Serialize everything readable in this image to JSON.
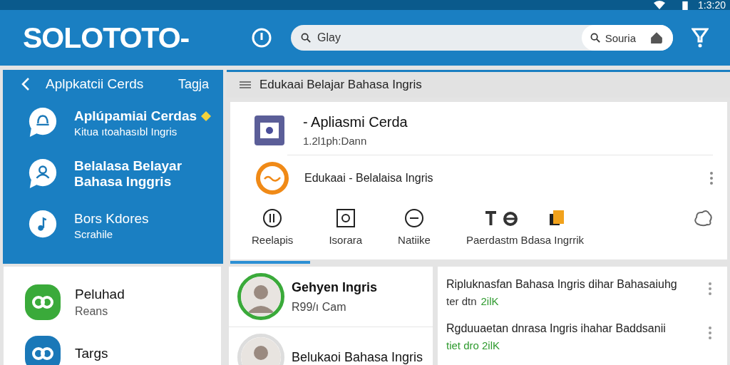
{
  "status_bar": {
    "time": "1:3:20"
  },
  "header": {
    "logo": "SOLOTOTO-",
    "search": {
      "placeholder": "Glay"
    },
    "search_button": "Souria"
  },
  "sidebar": {
    "title": "Aplpkatcii Cerds",
    "action": "Tagja",
    "items": [
      {
        "kind": "chat",
        "title": "Aplúpamiai Cerdas",
        "subtitle": "Kitua ıtoahasıbl Ingris",
        "starred": true
      },
      {
        "kind": "person",
        "title": "Belalasa Belayar Bahasa Inggris",
        "starred": false
      },
      {
        "kind": "music",
        "title": "Bors Kdores",
        "subtitle": "Scrahile",
        "starred": false
      }
    ]
  },
  "content": {
    "heading": "Edukaai Belajar Bahasa Ingris",
    "card": {
      "title": "- Apliasmi Cerda",
      "subtitle": "1.2l1ph:Dann",
      "app_name": "Edukaai - Belalaisa Ingris",
      "tabs": [
        {
          "kind": "circle-bars",
          "label": "Reelapis"
        },
        {
          "kind": "square",
          "label": "Isorara"
        },
        {
          "kind": "circle-dash",
          "label": "Natiike"
        },
        {
          "kind": "to",
          "label": "Paerdastm Bdasa Ingrrik"
        }
      ]
    },
    "progress": {
      "level": 0.16
    }
  },
  "apps": [
    {
      "color": "#3aaa3a",
      "title": "Peluhad",
      "subtitle": "Reans"
    },
    {
      "color": "#1a78b8",
      "title": "Targs"
    }
  ],
  "people": [
    {
      "name": "Gehyen Ingris",
      "meta": "R99/ı Cam",
      "color": "#3aaa3a"
    },
    {
      "name": "Belukaoi Bahasa Ingris",
      "color": "#dddddd"
    }
  ],
  "posts": [
    {
      "text": "Ripluknasfan Bahasa Ingris dihar Bahasaiuhg",
      "meta": "ter dtn",
      "highlight": "2ilK"
    },
    {
      "text": "Rgduuaetan dnrasa Ingris ihahar Baddsanii",
      "highlight": "tiet dro 2ilK"
    }
  ]
}
